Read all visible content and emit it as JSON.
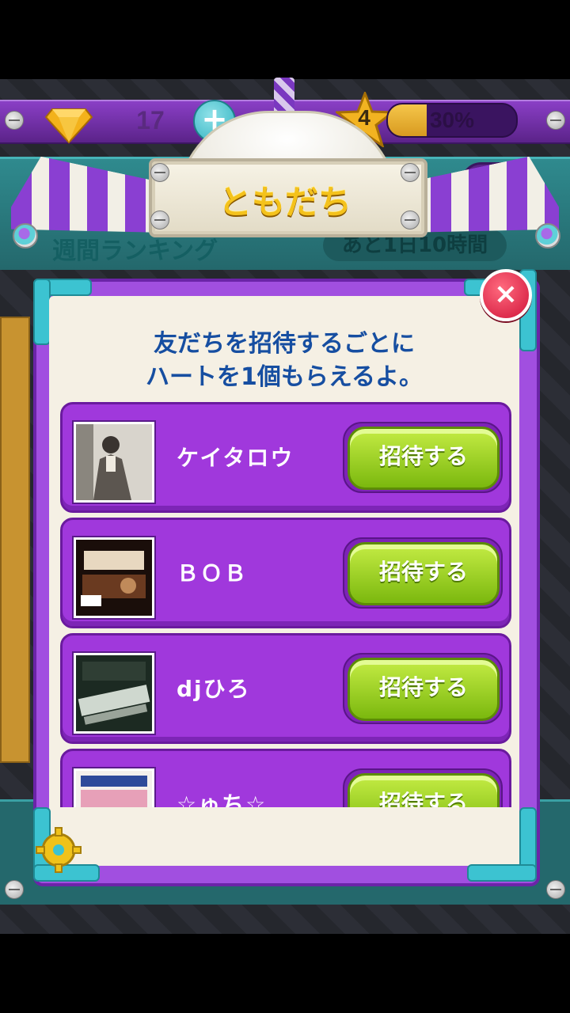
{
  "hud": {
    "gem_count": "17",
    "plus_label": "+",
    "level": "4",
    "progress_text": "30%",
    "progress_fraction": 0.3
  },
  "background": {
    "hearts": "♥♥",
    "mail_icon": "✉",
    "ranking_title": "週間ランキング",
    "ranking_time": "あと1日10時間"
  },
  "dialog": {
    "title": "ともだち",
    "intro_line1": "友だちを招待するごとに",
    "intro_line2": "ハートを1個もらえるよ。",
    "close_label": "×",
    "friends": [
      {
        "name": "ケイタロウ",
        "invite_label": "招待する"
      },
      {
        "name": "ＢＯＢ",
        "invite_label": "招待する"
      },
      {
        "name": "djひろ",
        "invite_label": "招待する"
      },
      {
        "name": "☆ゅち☆",
        "invite_label": "招待する"
      }
    ]
  },
  "colors": {
    "purple": "#a038dc",
    "green_button": "#7bb80e",
    "title_yellow": "#f4c21c",
    "text_blue": "#164ea1"
  }
}
